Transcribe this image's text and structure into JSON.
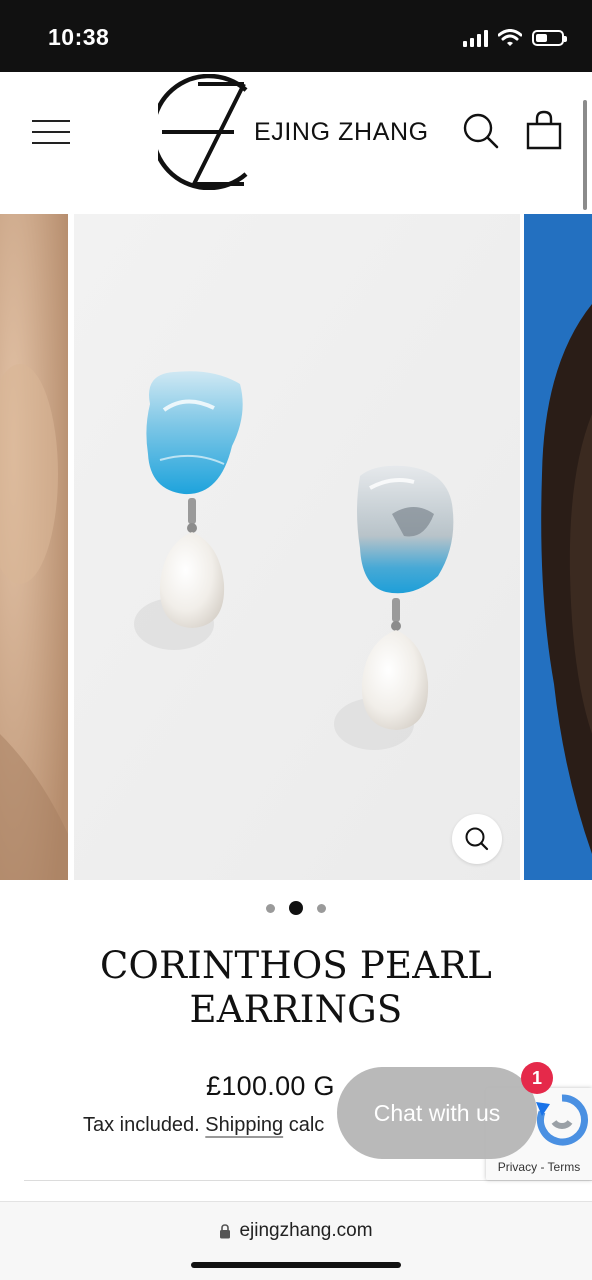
{
  "status_bar": {
    "time": "10:38",
    "icons": [
      "signal-icon",
      "wifi-icon",
      "battery-icon"
    ]
  },
  "header": {
    "brand_name": "EJING ZHANG",
    "logo_icon": "ez-monogram-logo",
    "menu_icon": "hamburger-menu-icon",
    "search_icon": "search-icon",
    "cart_icon": "shopping-bag-icon"
  },
  "gallery": {
    "slides": [
      "model-ear-photo",
      "earrings-product-photo",
      "model-portrait-photo"
    ],
    "active_index": 1,
    "dots_count": 3,
    "zoom_icon": "zoom-icon"
  },
  "product": {
    "title": "CORINTHOS PEARL EARRINGS",
    "price": "£100.00 G",
    "tax_text": "Tax included. ",
    "shipping_link": "Shipping",
    "shipping_rest": " calc"
  },
  "chat": {
    "label": "Chat with us",
    "badge_count": "1"
  },
  "recaptcha": {
    "terms_text": "Privacy - Terms"
  },
  "browser": {
    "url": "ejingzhang.com",
    "lock_icon": "lock-icon"
  },
  "colors": {
    "status_bar_bg": "#111111",
    "chat_button_bg": "#b4b4b4",
    "chat_badge": "#e5294a",
    "earring_blue": "#2aa6dc"
  }
}
